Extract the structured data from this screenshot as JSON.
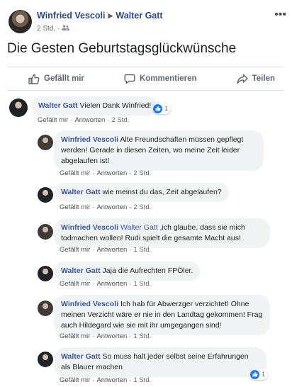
{
  "post": {
    "author": "Winfried Vescoli",
    "target": "Walter Gatt",
    "time": "2 Std.",
    "title": "Die Gesten Geburtstagsglückwünsche"
  },
  "actions": {
    "like": "Gefällt mir",
    "comment": "Kommentieren",
    "share": "Teilen"
  },
  "comment_meta": {
    "like": "Gefällt mir",
    "reply": "Antworten",
    "sep": "·"
  },
  "comments": [
    {
      "name": "Walter Gatt",
      "text": "Vielen Dank Winfried!",
      "time": "2 Std.",
      "reactions": "1"
    },
    {
      "name": "Winfried Vescoli",
      "text": "Alte Freundschaften müssen gepflegt werden! Gerade in diesen Zeiten, wo meine Zeit leider abgelaufen ist!",
      "time": "2 Std."
    },
    {
      "name": "Walter Gatt",
      "text": "wie meinst du das, Zeit abgelaufen?",
      "time": "2 Std."
    },
    {
      "name": "Winfried Vescoli",
      "tag": "Walter Gatt",
      "text": ",ich glaube, dass sie mich todmachen wollen! Rudi spielt die gesamte Macht aus!",
      "time": "1 Std."
    },
    {
      "name": "Walter Gatt",
      "text": "Jaja die Aufrechten FPÖler.",
      "time": "1 Std."
    },
    {
      "name": "Winfried Vescoli",
      "text": "Ich hab für Abwerzger verzichtet! Ohne meinen Verzicht wäre er nie in den Landtag gekommen! Frag auch Hildegard wie sie mit ihr umgegangen sind!",
      "time": "1 Std."
    },
    {
      "name": "Walter Gatt",
      "text": "So muss halt jeder selbst seine Erfahrungen als Blauer machen",
      "time": "1 Std.",
      "reactions": "1"
    }
  ],
  "colors": {
    "name_link": "#385898",
    "bubble_bg": "#f2f3f5",
    "meta_text": "#616770",
    "like_blue": "#1877f2"
  },
  "icons": {
    "header_arrow": "▶",
    "more": "•••"
  }
}
